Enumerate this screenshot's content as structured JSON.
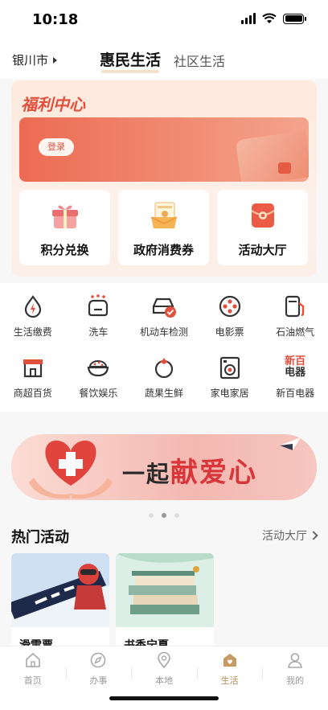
{
  "status_bar": {
    "time": "10:18"
  },
  "header": {
    "city": "银川市",
    "tab_active": "惠民生活",
    "tab_other": "社区生活"
  },
  "welfare": {
    "title": "福利中心",
    "login_label": "登录",
    "cards": [
      {
        "label": "积分兑换",
        "icon": "gift-box-icon"
      },
      {
        "label": "政府消费券",
        "icon": "coupon-icon"
      },
      {
        "label": "活动大厅",
        "icon": "red-envelope-icon"
      }
    ]
  },
  "services": [
    {
      "label": "生活缴费",
      "icon": "water-drop-bolt-icon"
    },
    {
      "label": "洗车",
      "icon": "car-wash-icon"
    },
    {
      "label": "机动车检测",
      "icon": "car-check-icon"
    },
    {
      "label": "电影票",
      "icon": "film-reel-icon"
    },
    {
      "label": "石油燃气",
      "icon": "fuel-pump-icon"
    },
    {
      "label": "商超百货",
      "icon": "store-icon"
    },
    {
      "label": "餐饮娱乐",
      "icon": "rice-bowl-icon"
    },
    {
      "label": "蔬果生鲜",
      "icon": "tomato-icon"
    },
    {
      "label": "家电家居",
      "icon": "washing-machine-icon"
    },
    {
      "label": "新百电器",
      "icon": "xinbai-logo-icon"
    }
  ],
  "xinbai_logo": {
    "line1": "新百",
    "line2": "电器"
  },
  "charity_banner": {
    "text_small": "一起",
    "text_big": "献爱心"
  },
  "hot": {
    "title": "热门活动",
    "more_label": "活动大厅",
    "cards": [
      {
        "title": "滑雪票"
      },
      {
        "title": "书香宁夏"
      }
    ]
  },
  "tabbar": [
    {
      "label": "首页",
      "icon": "home-icon",
      "active": false
    },
    {
      "label": "办事",
      "icon": "compass-icon",
      "active": false
    },
    {
      "label": "本地",
      "icon": "location-pin-icon",
      "active": false
    },
    {
      "label": "生活",
      "icon": "life-house-icon",
      "active": true
    },
    {
      "label": "我的",
      "icon": "user-icon",
      "active": false
    }
  ],
  "colors": {
    "accent_red": "#e0503c",
    "tab_active": "#b58a55",
    "icon_dark": "#333333"
  }
}
